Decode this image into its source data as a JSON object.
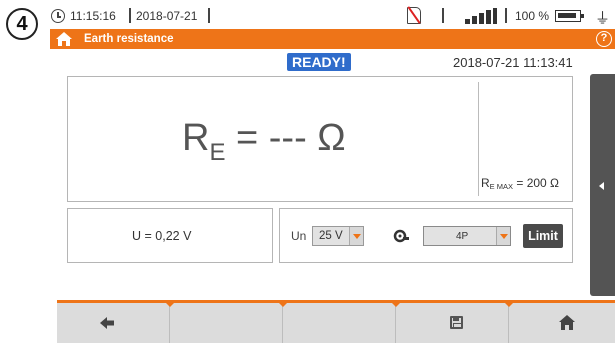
{
  "step": {
    "number": "4"
  },
  "status_bar": {
    "time": "11:15:16",
    "date": "2018-07-21",
    "battery_percent": "100 %",
    "icons": [
      "clock-icon",
      "no-sd-card-icon",
      "signal-strength-icon",
      "battery-icon",
      "plug-icon"
    ]
  },
  "header": {
    "title": "Earth resistance",
    "home_icon": "home-icon",
    "help_symbol": "?"
  },
  "status": {
    "ready_label": "READY!",
    "datetime": "2018-07-21 11:13:41"
  },
  "result": {
    "symbol": "R",
    "subscript": "E",
    "value_text": " = --- Ω",
    "limit_symbol": "R",
    "limit_subscript": "E MAX",
    "limit_value_text": " = 200 Ω"
  },
  "measurement": {
    "voltage_text": "U = 0,22 V"
  },
  "settings": {
    "un_label": "Un",
    "un_value": "25 V",
    "method_value": "4P",
    "limit_button": "Limit",
    "clamp_icon": "clamp-icon"
  },
  "bottom_nav": {
    "icons": [
      "back-arrow-icon",
      "save-icon",
      "home-icon"
    ]
  },
  "colors": {
    "accent": "#ee7418",
    "ready_bg": "#2f6ccb",
    "side_tab": "#545454"
  }
}
